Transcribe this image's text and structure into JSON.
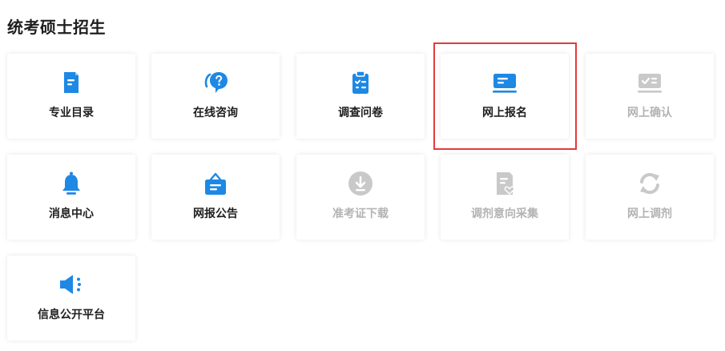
{
  "page": {
    "title": "统考硕士招生"
  },
  "colors": {
    "accent": "#1e88e5",
    "disabled": "#c9c9c9",
    "highlight": "#e5393b"
  },
  "tiles": [
    {
      "label": "专业目录",
      "icon": "catalog-document-icon",
      "enabled": true
    },
    {
      "label": "在线咨询",
      "icon": "question-chat-icon",
      "enabled": true
    },
    {
      "label": "调查问卷",
      "icon": "clipboard-checklist-icon",
      "enabled": true
    },
    {
      "label": "网上报名",
      "icon": "registration-monitor-icon",
      "enabled": true,
      "highlighted": true
    },
    {
      "label": "网上确认",
      "icon": "confirm-monitor-icon",
      "enabled": false
    },
    {
      "label": "消息中心",
      "icon": "bell-icon",
      "enabled": true
    },
    {
      "label": "网报公告",
      "icon": "notice-board-icon",
      "enabled": true
    },
    {
      "label": "准考证下载",
      "icon": "download-circle-icon",
      "enabled": false
    },
    {
      "label": "调剂意向采集",
      "icon": "document-heart-icon",
      "enabled": false
    },
    {
      "label": "网上调剂",
      "icon": "refresh-arrows-icon",
      "enabled": false
    },
    {
      "label": "信息公开平台",
      "icon": "speaker-icon",
      "enabled": true
    }
  ]
}
